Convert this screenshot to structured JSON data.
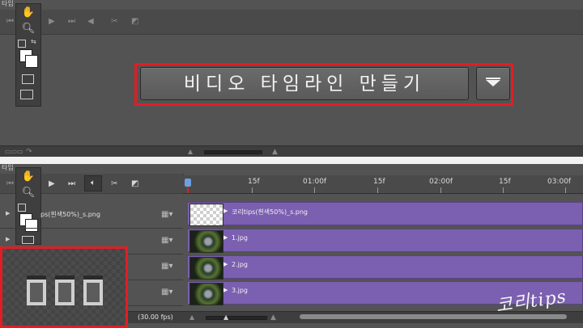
{
  "top_panel": {
    "tab_title": "타임",
    "create_button_label": "비디오 타임라인 만들기",
    "icons": {
      "hand": "hand-icon",
      "zoom": "zoom-icon",
      "scissors": "scissors-icon",
      "transition": "transition-icon",
      "dropdown": "triangle-down-icon"
    },
    "highlight_color": "#e01e24"
  },
  "bottom_panel": {
    "tab_title": "타임",
    "ruler_labels": [
      "15f",
      "01:00f",
      "15f",
      "02:00f",
      "15f",
      "03:00f"
    ],
    "layers": [
      {
        "name": "ps(흰색50%)_s.png",
        "clip_label": "코리tips(흰색50%)_s.png"
      },
      {
        "name": "",
        "clip_label": "1.jpg"
      },
      {
        "name": "",
        "clip_label": "2.jpg"
      },
      {
        "name": "",
        "clip_label": "3.jpg"
      }
    ],
    "fps": "(30.00 fps)",
    "clip_color": "#7b5fb0"
  },
  "watermark": "코리tips"
}
